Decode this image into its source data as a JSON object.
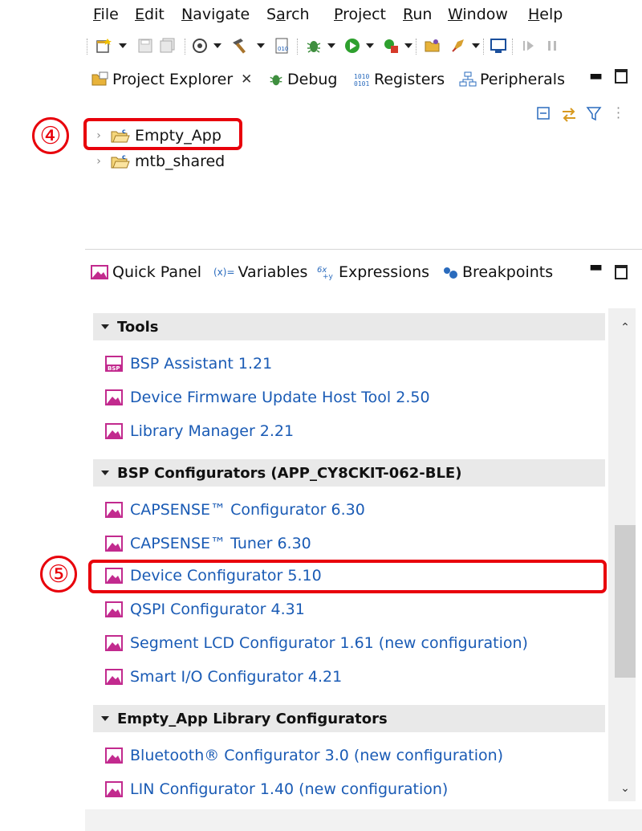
{
  "menubar": {
    "items": [
      {
        "label": "File",
        "mnemonic": "F",
        "rest": "ile"
      },
      {
        "label": "Edit",
        "mnemonic": "E",
        "rest": "dit"
      },
      {
        "label": "Navigate",
        "mnemonic": "N",
        "rest": "avigate"
      },
      {
        "label": "Search",
        "mnemonic": "a",
        "pre": "S",
        "rest": "rch"
      },
      {
        "label": "Project",
        "mnemonic": "P",
        "rest": "roject"
      },
      {
        "label": "Run",
        "mnemonic": "R",
        "rest": "un"
      },
      {
        "label": "Window",
        "mnemonic": "W",
        "rest": "indow"
      },
      {
        "label": "Help",
        "mnemonic": "H",
        "rest": "elp"
      }
    ]
  },
  "toolbar": {
    "icons": [
      "new-icon",
      "save-icon",
      "save-all-icon",
      "target-icon",
      "build-hammer-icon",
      "binary-file-icon",
      "debug-bug-icon",
      "run-icon",
      "run-external-icon",
      "open-folder-icon",
      "launch-icon",
      "terminal-icon",
      "step-icon"
    ]
  },
  "project_explorer": {
    "tabs": [
      {
        "label": "Project Explorer",
        "close": "✕"
      },
      {
        "label": "Debug"
      },
      {
        "label": "Registers"
      },
      {
        "label": "Peripherals"
      }
    ],
    "tree": [
      {
        "label": "Empty_App"
      },
      {
        "label": "mtb_shared"
      }
    ]
  },
  "quick_panel": {
    "tabs": [
      {
        "label": "Quick Panel"
      },
      {
        "label": "Variables",
        "prefix": "(x)="
      },
      {
        "label": "Expressions"
      },
      {
        "label": "Breakpoints"
      }
    ],
    "sections": [
      {
        "title": "Tools",
        "items": [
          "BSP Assistant 1.21",
          "Device Firmware Update Host Tool 2.50",
          "Library Manager 2.21"
        ]
      },
      {
        "title": "BSP Configurators (APP_CY8CKIT-062-BLE)",
        "items": [
          "CAPSENSE™ Configurator 6.30",
          "CAPSENSE™ Tuner 6.30",
          "Device Configurator 5.10",
          "QSPI Configurator 4.31",
          "Segment LCD Configurator 1.61 (new configuration)",
          "Smart I/O Configurator 4.21"
        ]
      },
      {
        "title": "Empty_App Library Configurators",
        "items": [
          "Bluetooth® Configurator 3.0 (new configuration)",
          "LIN Configurator 1.40 (new configuration)"
        ]
      }
    ]
  },
  "annotations": {
    "step4": "④",
    "step5": "⑤"
  },
  "colors": {
    "link": "#1a5bb5",
    "annotation": "#e8000b",
    "section_bg": "#e9e9e9"
  }
}
